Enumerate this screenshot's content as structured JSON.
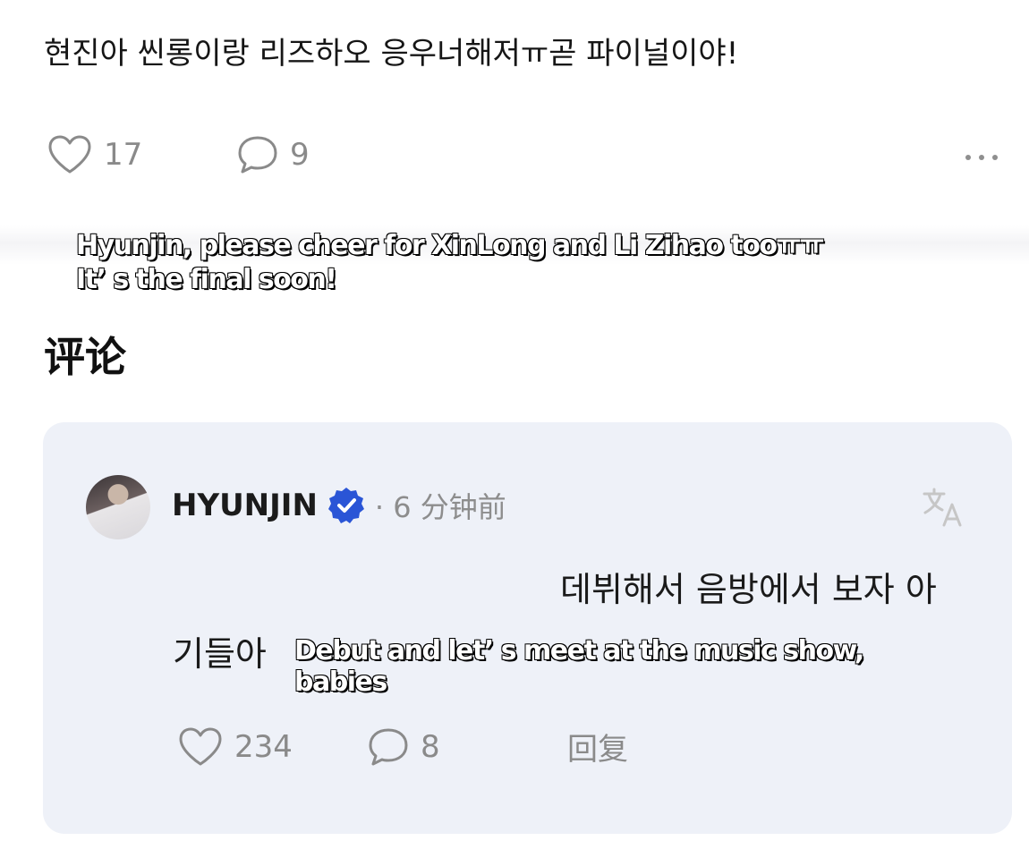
{
  "post": {
    "text": "현진아 씬롱이랑 리즈하오 응우너해저ㅠ곧 파이널이야!",
    "likes": "17",
    "comments": "9",
    "caption": "Hyunjin, please cheer for XinLong and Li Zihao tooㅠㅠ\nIt’ s the final soon!"
  },
  "comments_section": {
    "heading": "评论"
  },
  "comment": {
    "username": "HYUNJIN",
    "timestamp": "· 6 分钟前",
    "text_line1": "데뷔해서 음방에서 보자 아",
    "text_line2": "기들아",
    "caption": "Debut and let’ s meet at the music show,\nbabies",
    "likes": "234",
    "replies": "8",
    "reply_label": "回复"
  },
  "icons": {
    "like": "heart-icon",
    "comment": "speech-bubble-icon",
    "more": "more-dots-icon",
    "verified": "verified-badge-icon",
    "translate": "translate-icon"
  },
  "colors": {
    "card_background": "#eef1f8",
    "verified_badge": "#2a55d6",
    "muted_text": "#8a8a8a"
  }
}
